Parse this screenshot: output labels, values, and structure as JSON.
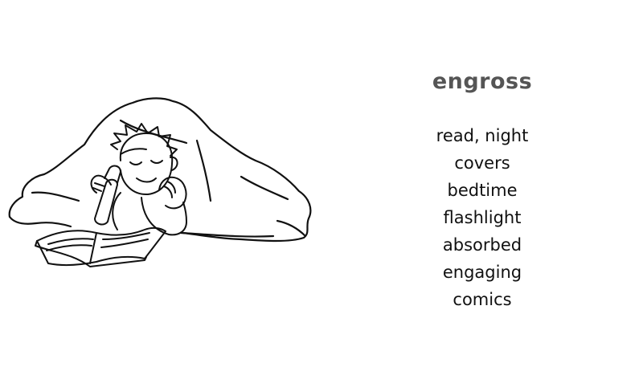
{
  "headword": "engross",
  "keywords": [
    "read, night",
    "covers",
    "bedtime",
    "flashlight",
    "absorbed",
    "engaging",
    "comics"
  ],
  "colors": {
    "headword": "#555555",
    "keywords": "#111111",
    "line_art": "#111111",
    "background": "#ffffff"
  },
  "illustration": {
    "subject": "boy reading a book under blanket with flashlight"
  }
}
